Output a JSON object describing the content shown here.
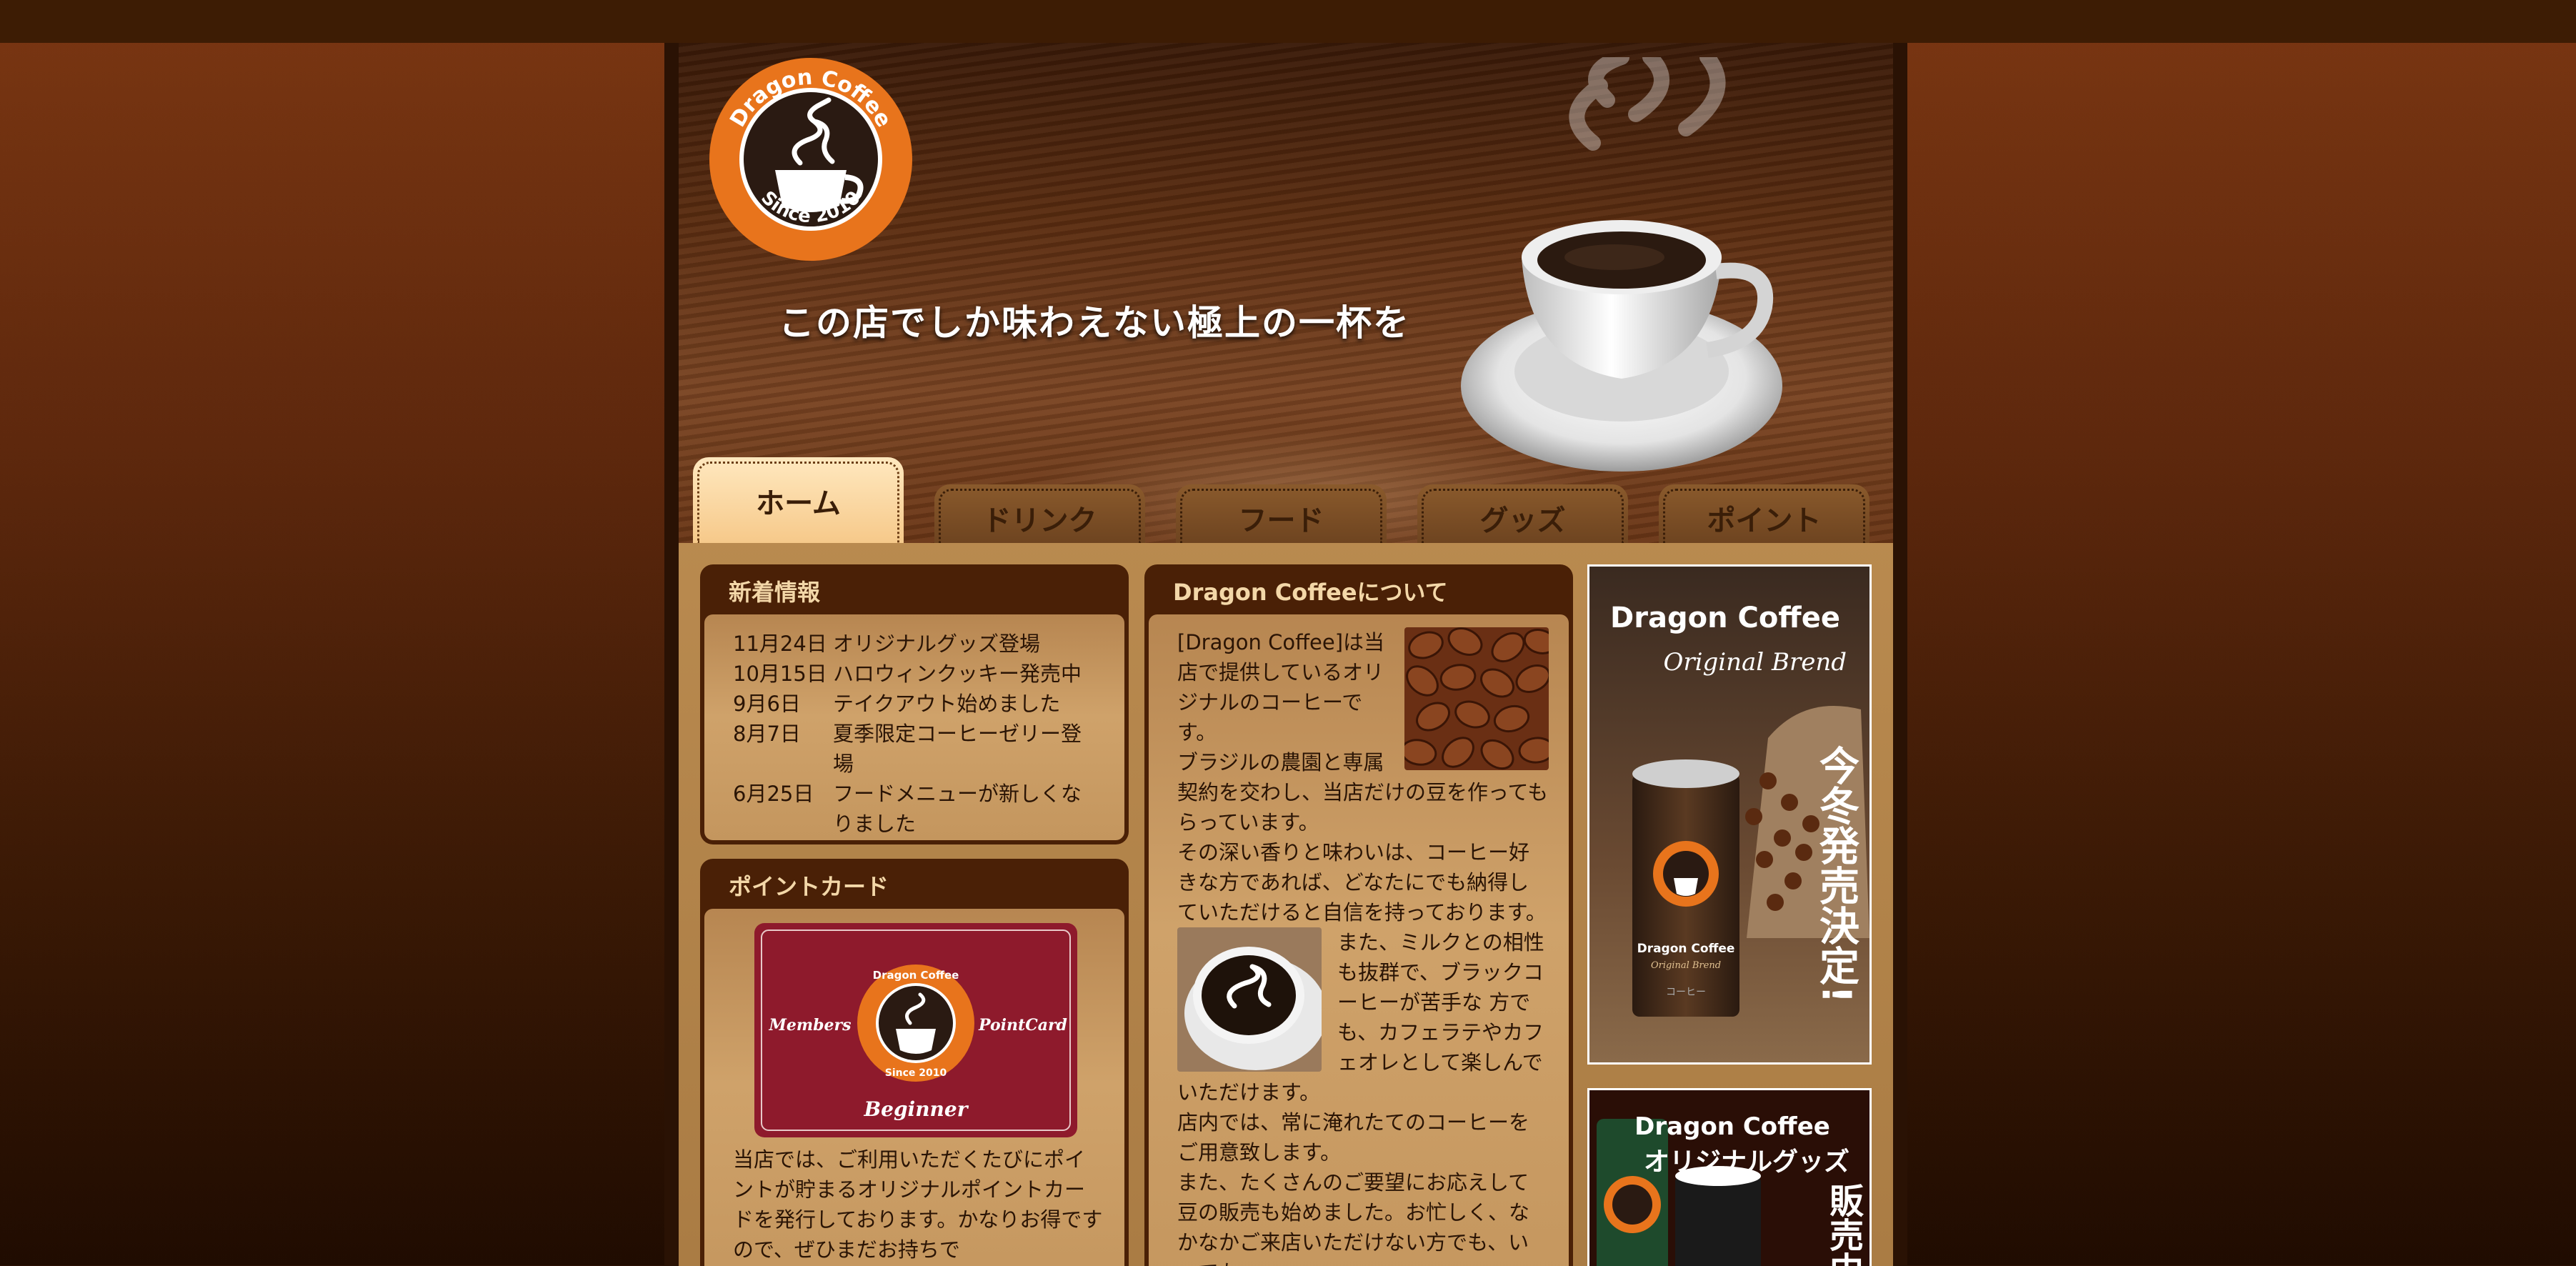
{
  "header": {
    "logo": {
      "top_text": "Dragon Coffee",
      "bottom_text": "Since 2010"
    },
    "tagline": "この店でしか味わえない極上の一杯を"
  },
  "nav": {
    "tabs": [
      {
        "label": "ホーム",
        "active": true
      },
      {
        "label": "ドリンク",
        "active": false
      },
      {
        "label": "フード",
        "active": false
      },
      {
        "label": "グッズ",
        "active": false
      },
      {
        "label": "ポイント",
        "active": false
      }
    ]
  },
  "news": {
    "title": "新着情報",
    "items": [
      {
        "date": "11月24日",
        "text": "オリジナルグッズ登場"
      },
      {
        "date": "10月15日",
        "text": "ハロウィンクッキー発売中"
      },
      {
        "date": "9月6日",
        "text": "テイクアウト始めました"
      },
      {
        "date": "8月7日",
        "text": "夏季限定コーヒーゼリー登場"
      },
      {
        "date": "6月25日",
        "text": "フードメニューが新しくなりました"
      }
    ]
  },
  "pointcard": {
    "title": "ポイントカード",
    "card": {
      "left": "Members",
      "right": "PointCard",
      "level": "Beginner",
      "logo_top": "Dragon Coffee",
      "logo_bottom": "Since 2010"
    },
    "text": "当店では、ご利用いただくたびにポイントが貯まるオリジナルポイントカードを発行しております。かなりお得ですので、ぜひまだお持ちで"
  },
  "about": {
    "title": "Dragon Coffeeについて",
    "p1": "[Dragon Coffee]は当店で提供しているオリジナルのコーヒーです。",
    "p2": "ブラジルの農園と専属契約を交わし、当店だけの豆を作ってもらっています。",
    "p3": "その深い香りと味わいは、コーヒー好きな方であれば、どなたにでも納得していただけると自信を持っております。",
    "p4": "また、ミルクとの相性も抜群で、ブラックコーヒーが苦手な 方でも、カフェラテやカフェオレとして楽しんでいただけます。",
    "p5": "店内では、常に淹れたてのコーヒーをご用意致します。",
    "p6": "また、たくさんのご要望にお応えして豆の販売も始めました。お忙しく、なかなかご来店いただけない方でも、いつでも"
  },
  "banners": {
    "can": {
      "title": "Dragon Coffee",
      "subtitle": "Original Brend",
      "vertical": "今冬発売決定!",
      "can_label": "Dragon Coffee",
      "can_sub": "Original Brend",
      "can_jp": "コーヒー"
    },
    "goods": {
      "title": "Dragon Coffee",
      "subtitle": "オリジナルグッズ",
      "vertical": "販売中"
    }
  }
}
